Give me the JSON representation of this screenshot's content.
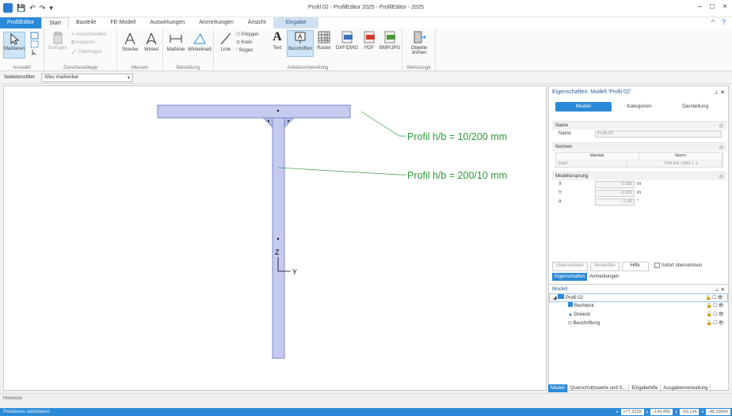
{
  "window": {
    "title": "Profil 02 - ProfilEditor 2025 - ProfilEditor - 2025",
    "controls": [
      "–",
      "□",
      "×"
    ]
  },
  "ribbon_tabs": {
    "file": "ProfilEditor",
    "start": "Start",
    "bauteile": "Bauteile",
    "fe_modell": "FE-Modell",
    "auswirkungen": "Auswirkungen",
    "anmerkungen": "Anmerkungen",
    "ansicht": "Ansicht",
    "eingabe": "Eingabe",
    "help": "?"
  },
  "ribbon": {
    "auswahl": {
      "label": "Auswahl",
      "markieren": "Markieren"
    },
    "zwischenablage": {
      "label": "Zwischenablage",
      "einfuegen": "Einfügen",
      "ausschneiden": "Ausschneiden",
      "kopieren": "Kopieren",
      "uebertragen": "Übertragen"
    },
    "messen": {
      "label": "Messen",
      "strecke": "Strecke",
      "winkel": "Winkel"
    },
    "bemassung": {
      "label": "Bemaßung",
      "masslinie": "Maßlinie",
      "winkelmass": "Winkelmaß"
    },
    "arbeitsvorbereitung": {
      "label": "Arbeitsvorbereitung",
      "linie": "Linie",
      "polygon": "Polygon",
      "kreis": "Kreis",
      "bogen": "Bogen",
      "text": "Text",
      "beschriften": "Beschriften",
      "raster": "Raster",
      "dxf": "DXF/DWG",
      "pdf": "PDF",
      "bmp": "BMP/JPG"
    },
    "werkzeuge": {
      "label": "Werkzeuge",
      "objekte_drehen": "Objekte drehen"
    }
  },
  "filter": {
    "label": "Selektionsfilter",
    "value": "Alles markierbar"
  },
  "canvas": {
    "annotation_top": "Profil h/b = 10/200 mm",
    "annotation_web": "Profil h/b = 200/10 mm",
    "axis_z": "Z",
    "axis_y": "Y"
  },
  "properties": {
    "header": "Eigenschaften: Modell 'Profil 02'",
    "tabs": [
      "Modell",
      "Kategorien",
      "Darstellung"
    ],
    "name_section": "Name",
    "name_label": "Name",
    "name_value": "Profil 02",
    "normen_section": "Normen",
    "normen_headers": [
      "Werkst.",
      "Norm"
    ],
    "normen_row": [
      "Stahl",
      "DIN EN 1993-1-1"
    ],
    "ursprung_section": "Modellursprung",
    "ursprung": [
      {
        "label": "X",
        "value": "0.000",
        "unit": "m"
      },
      {
        "label": "Y",
        "value": "0.000",
        "unit": "m"
      },
      {
        "label": "α",
        "value": "0.00",
        "unit": "°"
      }
    ],
    "buttons": {
      "uebernehmen": "Übernehmen",
      "verwerfen": "Verwerfen",
      "hilfe": "Hilfe",
      "sofort": "Sofort übernehmen"
    },
    "subtabs": [
      "Eigenschaften",
      "Anmerkungen"
    ]
  },
  "model_tree": {
    "header": "Modell",
    "items": [
      {
        "label": "Profil 02",
        "color": "#2b8ad8"
      },
      {
        "label": "Rechteck",
        "color": "#2b8ad8"
      },
      {
        "label": "Dreieck",
        "color": "#2b6fc0"
      },
      {
        "label": "Beschriftung",
        "color": "#666666"
      }
    ]
  },
  "bottom_tabs": [
    "Modell",
    "Querschnittswerte und S...",
    "Eingabehilfe",
    "Ausgabenverwaltung"
  ],
  "hints": {
    "label": "Hinweise"
  },
  "status": {
    "message": "Positionen selektieren",
    "coords": [
      {
        "label": "x",
        "value": "+77.2228"
      },
      {
        "label": "y",
        "value": "-143.460"
      },
      {
        "label": "z",
        "value": "-63.124"
      },
      {
        "label": "v",
        "value": "-46.03664"
      }
    ]
  },
  "colors": {
    "accent": "#2b8ad8",
    "profile_fill": "#c5cbef",
    "profile_stroke": "#7d87c9",
    "leader": "#3a9a4a",
    "annotation": "#2e9a3a"
  }
}
